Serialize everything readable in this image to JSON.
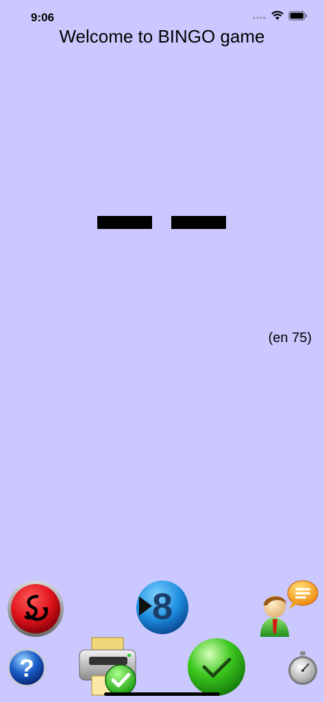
{
  "status": {
    "time": "9:06"
  },
  "header": {
    "title": "Welcome to BINGO game"
  },
  "game": {
    "total_label": "(en 75)"
  },
  "toolbar": {
    "next_number_digit": "8",
    "colors": {
      "restart": "#e0141c",
      "next": "#1f8fe0",
      "confirm": "#3cc81e",
      "help": "#1a5ec8"
    }
  }
}
